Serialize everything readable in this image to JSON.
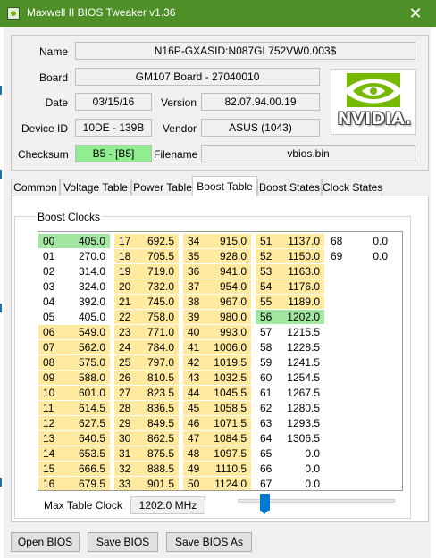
{
  "window": {
    "title": "Maxwell II BIOS Tweaker v1.36",
    "close_glyph": "✕"
  },
  "info": {
    "name_label": "Name",
    "name_value": "N16P-GXASID:N087GL752VW0.003$",
    "board_label": "Board",
    "board_value": "GM107 Board - 27040010",
    "date_label": "Date",
    "date_value": "03/15/16",
    "version_label": "Version",
    "version_value": "82.07.94.00.19",
    "device_id_label": "Device ID",
    "device_id_value": "10DE - 139B",
    "vendor_label": "Vendor",
    "vendor_value": "ASUS (1043)",
    "checksum_label": "Checksum",
    "checksum_value": "B5 - [B5]",
    "filename_label": "Filename",
    "filename_value": "vbios.bin"
  },
  "logo": {
    "text": "NVIDIA.",
    "eye_color": "#76b900"
  },
  "tabs": [
    {
      "label": "Common"
    },
    {
      "label": "Voltage Table"
    },
    {
      "label": "Power Table"
    },
    {
      "label": "Boost Table",
      "active": true
    },
    {
      "label": "Boost States"
    },
    {
      "label": "Clock States"
    }
  ],
  "boost": {
    "group_title": "Boost Clocks",
    "columns": [
      [
        {
          "i": "00",
          "v": "405.0",
          "c": "g"
        },
        {
          "i": "01",
          "v": "270.0",
          "c": "w"
        },
        {
          "i": "02",
          "v": "314.0",
          "c": "w"
        },
        {
          "i": "03",
          "v": "324.0",
          "c": "w"
        },
        {
          "i": "04",
          "v": "392.0",
          "c": "w"
        },
        {
          "i": "05",
          "v": "405.0",
          "c": "w"
        },
        {
          "i": "06",
          "v": "549.0",
          "c": "y"
        },
        {
          "i": "07",
          "v": "562.0",
          "c": "y"
        },
        {
          "i": "08",
          "v": "575.0",
          "c": "y"
        },
        {
          "i": "09",
          "v": "588.0",
          "c": "y"
        },
        {
          "i": "10",
          "v": "601.0",
          "c": "y"
        },
        {
          "i": "11",
          "v": "614.5",
          "c": "y"
        },
        {
          "i": "12",
          "v": "627.5",
          "c": "y"
        },
        {
          "i": "13",
          "v": "640.5",
          "c": "y"
        },
        {
          "i": "14",
          "v": "653.5",
          "c": "y"
        },
        {
          "i": "15",
          "v": "666.5",
          "c": "y"
        },
        {
          "i": "16",
          "v": "679.5",
          "c": "y"
        }
      ],
      [
        {
          "i": "17",
          "v": "692.5",
          "c": "y"
        },
        {
          "i": "18",
          "v": "705.5",
          "c": "y"
        },
        {
          "i": "19",
          "v": "719.0",
          "c": "y"
        },
        {
          "i": "20",
          "v": "732.0",
          "c": "y"
        },
        {
          "i": "21",
          "v": "745.0",
          "c": "y"
        },
        {
          "i": "22",
          "v": "758.0",
          "c": "y"
        },
        {
          "i": "23",
          "v": "771.0",
          "c": "y"
        },
        {
          "i": "24",
          "v": "784.0",
          "c": "y"
        },
        {
          "i": "25",
          "v": "797.0",
          "c": "y"
        },
        {
          "i": "26",
          "v": "810.5",
          "c": "y"
        },
        {
          "i": "27",
          "v": "823.5",
          "c": "y"
        },
        {
          "i": "28",
          "v": "836.5",
          "c": "y"
        },
        {
          "i": "29",
          "v": "849.5",
          "c": "y"
        },
        {
          "i": "30",
          "v": "862.5",
          "c": "y"
        },
        {
          "i": "31",
          "v": "875.5",
          "c": "y"
        },
        {
          "i": "32",
          "v": "888.5",
          "c": "y"
        },
        {
          "i": "33",
          "v": "901.5",
          "c": "y"
        }
      ],
      [
        {
          "i": "34",
          "v": "915.0",
          "c": "y"
        },
        {
          "i": "35",
          "v": "928.0",
          "c": "y"
        },
        {
          "i": "36",
          "v": "941.0",
          "c": "y"
        },
        {
          "i": "37",
          "v": "954.0",
          "c": "y"
        },
        {
          "i": "38",
          "v": "967.0",
          "c": "y"
        },
        {
          "i": "39",
          "v": "980.0",
          "c": "y"
        },
        {
          "i": "40",
          "v": "993.0",
          "c": "y"
        },
        {
          "i": "41",
          "v": "1006.0",
          "c": "y"
        },
        {
          "i": "42",
          "v": "1019.5",
          "c": "y"
        },
        {
          "i": "43",
          "v": "1032.5",
          "c": "y"
        },
        {
          "i": "44",
          "v": "1045.5",
          "c": "y"
        },
        {
          "i": "45",
          "v": "1058.5",
          "c": "y"
        },
        {
          "i": "46",
          "v": "1071.5",
          "c": "y"
        },
        {
          "i": "47",
          "v": "1084.5",
          "c": "y"
        },
        {
          "i": "48",
          "v": "1097.5",
          "c": "y"
        },
        {
          "i": "49",
          "v": "1110.5",
          "c": "y"
        },
        {
          "i": "50",
          "v": "1124.0",
          "c": "y"
        }
      ],
      [
        {
          "i": "51",
          "v": "1137.0",
          "c": "y"
        },
        {
          "i": "52",
          "v": "1150.0",
          "c": "y"
        },
        {
          "i": "53",
          "v": "1163.0",
          "c": "y"
        },
        {
          "i": "54",
          "v": "1176.0",
          "c": "y"
        },
        {
          "i": "55",
          "v": "1189.0",
          "c": "y"
        },
        {
          "i": "56",
          "v": "1202.0",
          "c": "g"
        },
        {
          "i": "57",
          "v": "1215.5",
          "c": "w"
        },
        {
          "i": "58",
          "v": "1228.5",
          "c": "w"
        },
        {
          "i": "59",
          "v": "1241.5",
          "c": "w"
        },
        {
          "i": "60",
          "v": "1254.5",
          "c": "w"
        },
        {
          "i": "61",
          "v": "1267.5",
          "c": "w"
        },
        {
          "i": "62",
          "v": "1280.5",
          "c": "w"
        },
        {
          "i": "63",
          "v": "1293.5",
          "c": "w"
        },
        {
          "i": "64",
          "v": "1306.5",
          "c": "w"
        },
        {
          "i": "65",
          "v": "0.0",
          "c": "w"
        },
        {
          "i": "66",
          "v": "0.0",
          "c": "w"
        },
        {
          "i": "67",
          "v": "0.0",
          "c": "w"
        }
      ],
      [
        {
          "i": "68",
          "v": "0.0",
          "c": "w"
        },
        {
          "i": "69",
          "v": "0.0",
          "c": "w"
        }
      ]
    ],
    "max_table_clock_label": "Max Table Clock",
    "max_table_clock_value": "1202.0 MHz",
    "slider_position": 0.15
  },
  "buttons": {
    "open_bios": "Open BIOS",
    "save_bios": "Save BIOS",
    "save_bios_as": "Save BIOS As"
  },
  "colors": {
    "titlebar": "#4e8f28",
    "highlight_yellow": "#ffeaa0",
    "highlight_green": "#a3e7a3",
    "checksum_green": "#90ee90"
  }
}
